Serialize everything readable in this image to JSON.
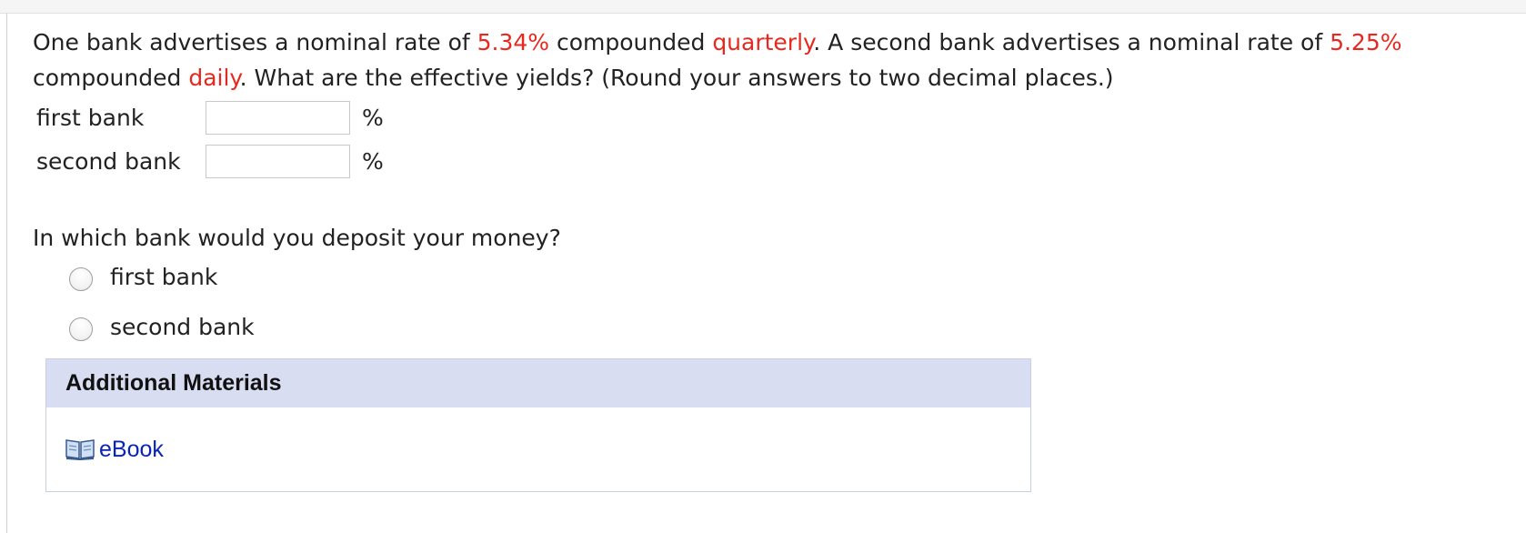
{
  "question": {
    "p1": "One bank advertises a nominal rate of ",
    "rate1": "5.34%",
    "p2": " compounded ",
    "freq1": "quarterly",
    "p3": ". A second bank advertises a nominal rate of ",
    "rate2": "5.25%",
    "p4": " compounded ",
    "freq2": "daily",
    "p5": ". What are the effective yields? (Round your answers to two decimal places.)"
  },
  "answers": [
    {
      "label": "first bank",
      "value": "",
      "unit": "%"
    },
    {
      "label": "second bank",
      "value": "",
      "unit": "%"
    }
  ],
  "question2": "In which bank would you deposit your money?",
  "choices": [
    {
      "label": "first bank"
    },
    {
      "label": "second bank"
    }
  ],
  "materials": {
    "header": "Additional Materials",
    "ebook_label": "eBook"
  },
  "colors": {
    "highlight": "#e8281f",
    "link": "#0a24b4",
    "materials_header_bg": "#d9ddf2"
  },
  "icons": {
    "ebook": "book-icon"
  }
}
